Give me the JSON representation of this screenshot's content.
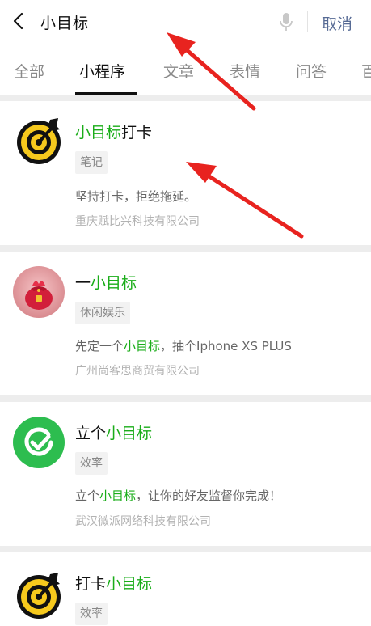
{
  "search": {
    "query": "小目标",
    "cancel_label": "取消"
  },
  "tabs": [
    {
      "label": "全部"
    },
    {
      "label": "小程序",
      "active": true
    },
    {
      "label": "文章"
    },
    {
      "label": "表情"
    },
    {
      "label": "问答"
    },
    {
      "label": "百"
    }
  ],
  "results": [
    {
      "title_pre": "",
      "title_hl": "小目标",
      "title_post": "打卡",
      "tag": "笔记",
      "desc_pre": "坚持打卡，拒绝拖延。",
      "desc_hl": "",
      "desc_post": "",
      "company": "重庆赋比兴科技有限公司",
      "icon": "target-icon"
    },
    {
      "title_pre": "一",
      "title_hl": "小目标",
      "title_post": "",
      "tag": "休闲娱乐",
      "desc_pre": "先定一个",
      "desc_hl": "小目标",
      "desc_post": "，抽个Iphone XS PLUS",
      "company": "广州尚客思商贸有限公司",
      "icon": "lucky-bag-icon"
    },
    {
      "title_pre": "立个",
      "title_hl": "小目标",
      "title_post": "",
      "tag": "效率",
      "desc_pre": "立个",
      "desc_hl": "小目标",
      "desc_post": "，让你的好友监督你完成！",
      "company": "武汉微派网络科技有限公司",
      "icon": "check-circle-icon"
    },
    {
      "title_pre": "打卡",
      "title_hl": "小目标",
      "title_post": "",
      "tag": "效率",
      "icon": "target-icon"
    }
  ],
  "colors": {
    "highlight": "#1aad19",
    "link": "#576b95",
    "arrow": "#e8231f"
  }
}
